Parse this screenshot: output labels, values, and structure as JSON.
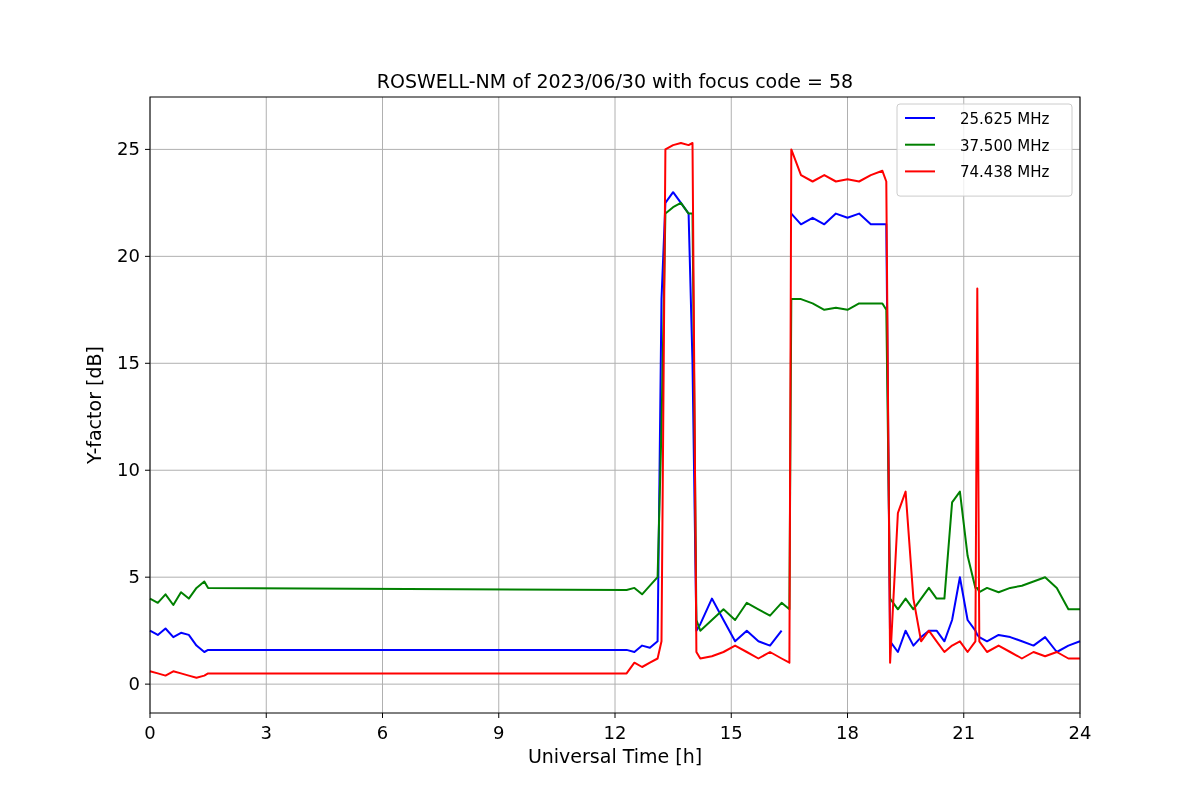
{
  "figure": {
    "chart_data": {
      "type": "line",
      "title": "ROSWELL-NM of 2023/06/30 with focus code = 58",
      "xlabel": "Universal Time [h]",
      "ylabel": "Y-factor [dB]",
      "x": [
        0,
        0.2,
        0.4,
        0.6,
        0.8,
        1.0,
        1.2,
        1.4,
        1.5,
        12.3,
        12.5,
        12.7,
        12.9,
        13.1,
        13.2,
        13.3,
        13.5,
        13.7,
        13.9,
        14.0,
        14.1,
        14.2,
        14.5,
        14.8,
        15.1,
        15.4,
        15.7,
        16.0,
        16.3,
        16.5,
        16.55,
        16.8,
        17.1,
        17.4,
        17.7,
        18.0,
        18.3,
        18.6,
        18.9,
        19.0,
        19.1,
        19.3,
        19.5,
        19.7,
        19.9,
        20.1,
        20.3,
        20.5,
        20.7,
        20.9,
        21.1,
        21.3,
        21.35,
        21.4,
        21.6,
        21.9,
        22.2,
        22.5,
        22.8,
        23.1,
        23.4,
        23.7,
        24
      ],
      "series": [
        {
          "name": "25.625 MHz",
          "color": "#0000ff",
          "values": [
            2.5,
            2.3,
            2.6,
            2.2,
            2.4,
            2.3,
            1.8,
            1.5,
            1.6,
            1.6,
            1.5,
            1.8,
            1.7,
            2.0,
            18,
            22.5,
            23,
            22.5,
            22,
            15,
            2.5,
            2.8,
            4,
            3,
            2,
            2.5,
            2,
            1.8,
            2.5,
            null,
            22,
            21.5,
            21.8,
            21.5,
            22,
            21.8,
            22,
            21.5,
            21.5,
            21.5,
            2,
            1.5,
            2.5,
            1.8,
            2.2,
            2.5,
            2.5,
            2,
            3,
            5,
            3,
            2.5,
            2.3,
            2.2,
            2,
            2.3,
            2.2,
            2,
            1.8,
            2.2,
            1.5,
            1.8,
            2
          ]
        },
        {
          "name": "37.500 MHz",
          "color": "#008000",
          "values": [
            4,
            3.8,
            4.2,
            3.7,
            4.3,
            4,
            4.5,
            4.8,
            4.5,
            4.4,
            4.5,
            4.2,
            4.6,
            5,
            12,
            22,
            22.3,
            22.5,
            22,
            22,
            3,
            2.5,
            3,
            3.5,
            3,
            3.8,
            3.5,
            3.2,
            3.8,
            3.5,
            18,
            18,
            17.8,
            17.5,
            17.6,
            17.5,
            17.8,
            17.8,
            17.8,
            17.5,
            4,
            3.5,
            4,
            3.5,
            4,
            4.5,
            4,
            4,
            8.5,
            9,
            6,
            4.5,
            4.5,
            4.3,
            4.5,
            4.3,
            4.5,
            4.6,
            4.8,
            5,
            4.5,
            3.5,
            3.5
          ]
        },
        {
          "name": "74.438 MHz",
          "color": "#ff0000",
          "values": [
            0.6,
            0.5,
            0.4,
            0.6,
            0.5,
            0.4,
            0.3,
            0.4,
            0.5,
            0.5,
            1,
            0.8,
            1,
            1.2,
            2,
            25,
            25.2,
            25.3,
            25.2,
            25.3,
            1.5,
            1.2,
            1.3,
            1.5,
            1.8,
            1.5,
            1.2,
            1.5,
            1.2,
            1,
            25,
            23.8,
            23.5,
            23.8,
            23.5,
            23.6,
            23.5,
            23.8,
            24,
            23.5,
            1,
            8,
            9,
            4,
            2,
            2.5,
            2,
            1.5,
            1.8,
            2,
            1.5,
            2,
            18.5,
            2,
            1.5,
            1.8,
            1.5,
            1.2,
            1.5,
            1.3,
            1.5,
            1.2,
            1.2
          ]
        }
      ],
      "xlim": [
        0,
        24
      ],
      "ylim": [
        -1.35,
        27.45
      ],
      "xticks": [
        0,
        3,
        6,
        9,
        12,
        15,
        18,
        21,
        24
      ],
      "yticks": [
        0,
        5,
        10,
        15,
        20,
        25
      ],
      "grid": true,
      "legend": true
    }
  }
}
